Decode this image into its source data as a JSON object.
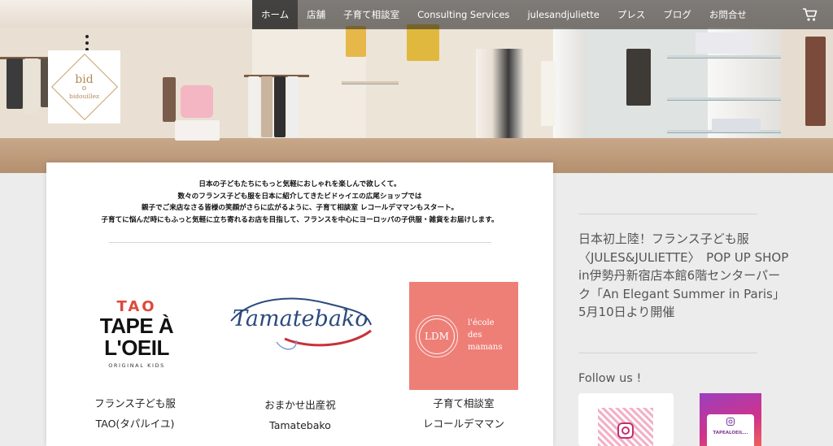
{
  "nav": {
    "items": [
      {
        "label": "ホーム",
        "active": true
      },
      {
        "label": "店舗"
      },
      {
        "label": "子育て相談室"
      },
      {
        "label": "Consulting Services"
      },
      {
        "label": "julesandjuliette"
      },
      {
        "label": "プレス"
      },
      {
        "label": "ブログ"
      },
      {
        "label": "お問合せ"
      }
    ],
    "cart_icon": "cart-icon"
  },
  "logo": {
    "main": "bid",
    "sub": "bidouillez"
  },
  "intro": {
    "lines": [
      "日本の子どもたちにもっと気軽におしゃれを楽しんで欲しくて。",
      "数々のフランス子ども服を日本に紹介してきたビドゥイエの広尾ショップでは",
      "親子でご来店なさる皆様の笑顔がさらに広がるように、子育て相談室 レコールデママンもスタート。",
      "子育てに悩んだ時にもふっと気軽に立ち寄れるお店を目指して、フランスを中心にヨーロッパの子供服・雑貨をお届けします。"
    ]
  },
  "brands": [
    {
      "logo": {
        "top": "TAO",
        "line1": "TAPE À",
        "line2": "L'OEIL",
        "tagline": "ORIGINAL KIDS"
      },
      "name1": "フランス子ども服",
      "name2": "TAO(タパルイユ)"
    },
    {
      "logo": {
        "text": "Tamatebako"
      },
      "name1": "おまかせ出産祝",
      "name2": "Tamatebako"
    },
    {
      "logo": {
        "abbr": "LDM",
        "line1": "l'école",
        "line2": "des",
        "line3": "mamans"
      },
      "name1": "子育て相談室",
      "name2": "レコールデママン"
    }
  ],
  "sidebar": {
    "news": "日本初上陸！フランス子ども服〈JULES&JULIETTE〉　POP UP SHOP in伊勢丹新宿店本館6階センターパーク「An Elegant Summer in Paris」 5月10日より開催",
    "follow": "Follow us !",
    "insta_label": "TAPEALOEIL..."
  },
  "colors": {
    "accent_red": "#e0473b",
    "ldm_pink": "#ee7f77",
    "logo_gold": "#c9a06a"
  }
}
